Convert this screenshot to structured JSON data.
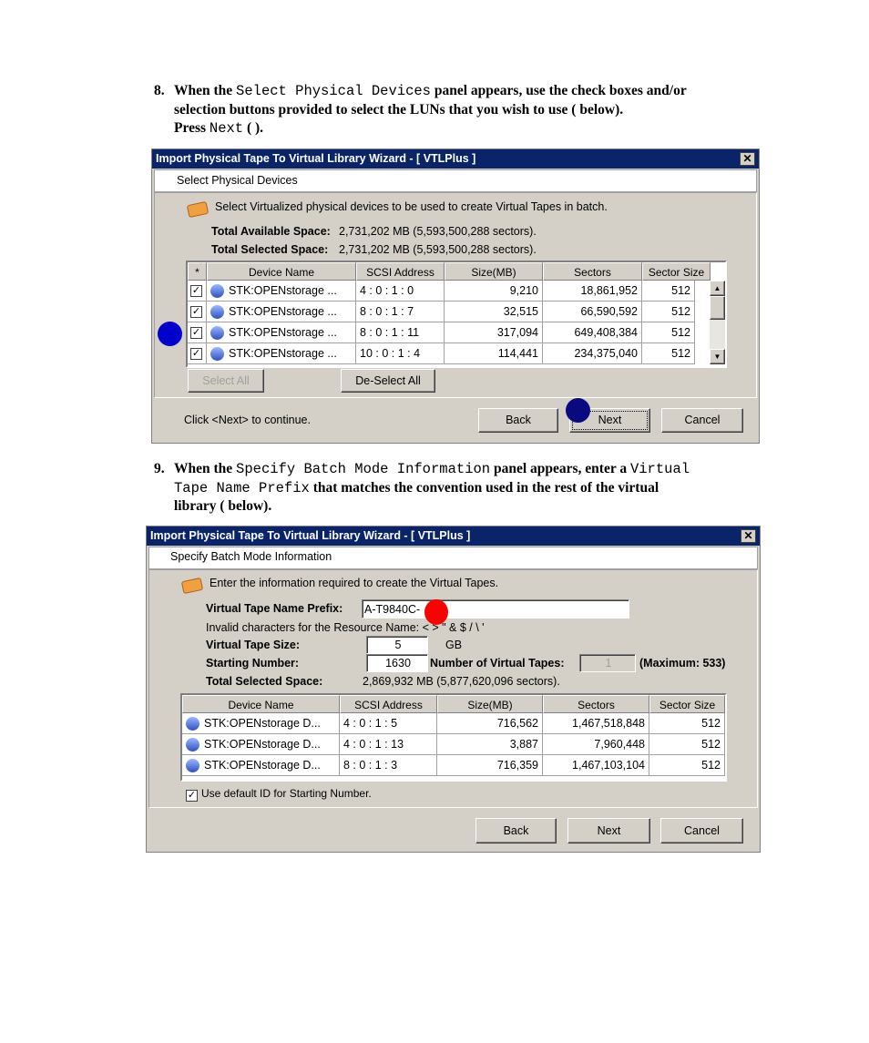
{
  "step8": {
    "num": "8.",
    "t1": "When the ",
    "code1": "Select Physical Devices",
    "t2": " panel appears, use the check boxes and/or",
    "t3": "selection buttons provided to select the LUNs that you wish to use (   below).",
    "t4": "Press ",
    "code2": "Next",
    "t5": " (  )."
  },
  "step9": {
    "num": "9.",
    "t1": "When the ",
    "code1": "Specify Batch Mode Information",
    "t2": " panel appears, enter a ",
    "code2": "Virtual",
    "code3": "Tape Name Prefix",
    "t3": " that matches the convention used in the rest of the virtual",
    "t4": "library (   below)."
  },
  "dialog1": {
    "title": "Import Physical Tape To Virtual Library Wizard - [ VTLPlus ]",
    "header": "Select Physical Devices",
    "intro": "Select Virtualized physical devices to be used to create Virtual Tapes in batch.",
    "available_label": "Total Available Space:",
    "available_value": "2,731,202 MB (5,593,500,288 sectors).",
    "selected_label": "Total Selected Space:",
    "selected_value": "2,731,202 MB (5,593,500,288 sectors).",
    "columns": [
      "*",
      "Device Name",
      "SCSI Address",
      "Size(MB)",
      "Sectors",
      "Sector Size"
    ],
    "rows": [
      {
        "checked": true,
        "device": "STK:OPENstorage ...",
        "scsi": "4 : 0 : 1 : 0",
        "size": "9,210",
        "sectors": "18,861,952",
        "sector_size": "512"
      },
      {
        "checked": true,
        "device": "STK:OPENstorage ...",
        "scsi": "8 : 0 : 1 : 7",
        "size": "32,515",
        "sectors": "66,590,592",
        "sector_size": "512"
      },
      {
        "checked": true,
        "device": "STK:OPENstorage ...",
        "scsi": "8 : 0 : 1 : 11",
        "size": "317,094",
        "sectors": "649,408,384",
        "sector_size": "512"
      },
      {
        "checked": true,
        "device": "STK:OPENstorage ...",
        "scsi": "10 : 0 : 1 : 4",
        "size": "114,441",
        "sectors": "234,375,040",
        "sector_size": "512"
      }
    ],
    "select_all": "Select All",
    "deselect_all": "De-Select All",
    "footer": "Click <Next> to continue.",
    "back": "Back",
    "next": "Next",
    "cancel": "Cancel"
  },
  "dialog2": {
    "title": "Import Physical Tape To Virtual Library Wizard - [ VTLPlus ]",
    "header": "Specify Batch Mode Information",
    "intro": "Enter the information required to create the Virtual Tapes.",
    "prefix_label": "Virtual Tape Name Prefix:",
    "prefix_value": "A-T9840C-",
    "invalid_note": "Invalid characters for the Resource Name: < > \" & $ / \\ '",
    "size_label": "Virtual Tape Size:",
    "size_value": "5",
    "size_unit": "GB",
    "start_label": "Starting Number:",
    "start_value": "1630",
    "count_label": "Number of Virtual Tapes:",
    "count_value": "1",
    "max_note": "(Maximum: 533)",
    "selected_label": "Total Selected Space:",
    "selected_value": "2,869,932 MB (5,877,620,096 sectors).",
    "columns": [
      "Device Name",
      "SCSI Address",
      "Size(MB)",
      "Sectors",
      "Sector Size"
    ],
    "rows": [
      {
        "device": "STK:OPENstorage D...",
        "scsi": "4 : 0 : 1 : 5",
        "size": "716,562",
        "sectors": "1,467,518,848",
        "sector_size": "512"
      },
      {
        "device": "STK:OPENstorage D...",
        "scsi": "4 : 0 : 1 : 13",
        "size": "3,887",
        "sectors": "7,960,448",
        "sector_size": "512"
      },
      {
        "device": "STK:OPENstorage D...",
        "scsi": "8 : 0 : 1 : 3",
        "size": "716,359",
        "sectors": "1,467,103,104",
        "sector_size": "512"
      }
    ],
    "use_default_label": "Use default ID for Starting Number.",
    "use_default_checked": true,
    "back": "Back",
    "next": "Next",
    "cancel": "Cancel"
  },
  "markers": {
    "blue": "#0000cc",
    "red": "#ff0000"
  }
}
